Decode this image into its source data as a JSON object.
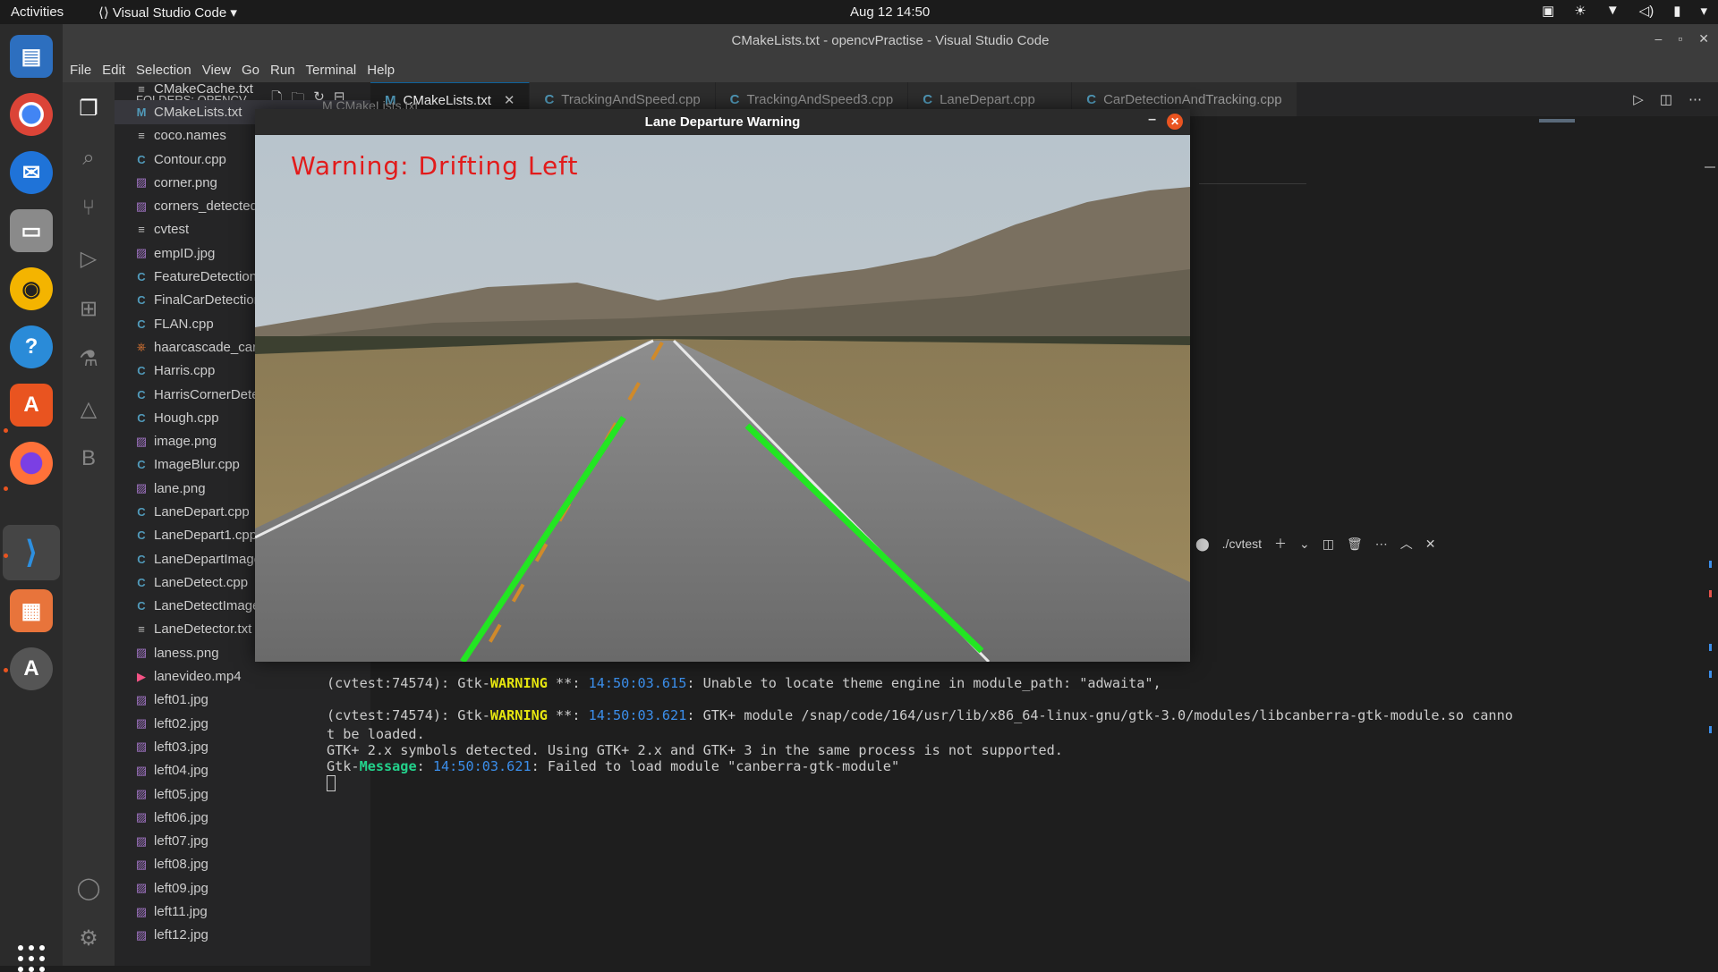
{
  "topbar": {
    "activities": "Activities",
    "app_name": "Visual Studio Code",
    "clock": "Aug 12  14:50"
  },
  "dock": {
    "items": [
      "text-editor-icon",
      "chrome-icon",
      "thunderbird-icon",
      "files-icon",
      "rhythmbox-icon",
      "help-icon",
      "software-center-icon",
      "firefox-icon",
      "vscode-icon",
      "impress-icon",
      "software-updater-icon"
    ]
  },
  "window": {
    "title": "CMakeLists.txt - opencvPractise - Visual Studio Code"
  },
  "menu": [
    "File",
    "Edit",
    "Selection",
    "View",
    "Go",
    "Run",
    "Terminal",
    "Help"
  ],
  "explorer": {
    "header": "FOLDERS: OPENCV...",
    "files": [
      {
        "name": "CMakeCache.txt",
        "type": "txt"
      },
      {
        "name": "CMakeLists.txt",
        "type": "cmake",
        "selected": true
      },
      {
        "name": "coco.names",
        "type": "txt"
      },
      {
        "name": "Contour.cpp",
        "type": "cpp"
      },
      {
        "name": "corner.png",
        "type": "img"
      },
      {
        "name": "corners_detected.png",
        "type": "img"
      },
      {
        "name": "cvtest",
        "type": "txt"
      },
      {
        "name": "empID.jpg",
        "type": "img"
      },
      {
        "name": "FeatureDetection.cpp",
        "type": "cpp"
      },
      {
        "name": "FinalCarDetection.cpp",
        "type": "cpp"
      },
      {
        "name": "FLAN.cpp",
        "type": "cpp"
      },
      {
        "name": "haarcascade_car.xml",
        "type": "xml"
      },
      {
        "name": "Harris.cpp",
        "type": "cpp"
      },
      {
        "name": "HarrisCornerDetection.cp",
        "type": "cpp"
      },
      {
        "name": "Hough.cpp",
        "type": "cpp"
      },
      {
        "name": "image.png",
        "type": "img"
      },
      {
        "name": "ImageBlur.cpp",
        "type": "cpp"
      },
      {
        "name": "lane.png",
        "type": "img"
      },
      {
        "name": "LaneDepart.cpp",
        "type": "cpp"
      },
      {
        "name": "LaneDepart1.cpp",
        "type": "cpp"
      },
      {
        "name": "LaneDepartImage.cpp",
        "type": "cpp"
      },
      {
        "name": "LaneDetect.cpp",
        "type": "cpp"
      },
      {
        "name": "LaneDetectImage.cpp",
        "type": "cpp"
      },
      {
        "name": "LaneDetector.txt",
        "type": "txt"
      },
      {
        "name": "laness.png",
        "type": "img"
      },
      {
        "name": "lanevideo.mp4",
        "type": "mp4"
      },
      {
        "name": "left01.jpg",
        "type": "img"
      },
      {
        "name": "left02.jpg",
        "type": "img"
      },
      {
        "name": "left03.jpg",
        "type": "img"
      },
      {
        "name": "left04.jpg",
        "type": "img"
      },
      {
        "name": "left05.jpg",
        "type": "img"
      },
      {
        "name": "left06.jpg",
        "type": "img"
      },
      {
        "name": "left07.jpg",
        "type": "img"
      },
      {
        "name": "left08.jpg",
        "type": "img"
      },
      {
        "name": "left09.jpg",
        "type": "img"
      },
      {
        "name": "left11.jpg",
        "type": "img"
      },
      {
        "name": "left12.jpg",
        "type": "img"
      }
    ]
  },
  "tabs": [
    {
      "label": "CMakeLists.txt",
      "icon": "M",
      "active": true
    },
    {
      "label": "TrackingAndSpeed.cpp",
      "icon": "C"
    },
    {
      "label": "TrackingAndSpeed3.cpp",
      "icon": "C"
    },
    {
      "label": "LaneDepart.cpp",
      "icon": "C"
    },
    {
      "label": "CarDetectionAndTracking.cpp",
      "icon": "C"
    }
  ],
  "breadcrumb": "M CMakeLists.txt",
  "terminal": {
    "shell_label": "./cvtest",
    "lines": [
      [
        {
          "t": "(cvtest:74574): Gtk-"
        },
        {
          "t": "WARNING",
          "c": "w-yel"
        },
        {
          "t": " **: "
        },
        {
          "t": "14:50:03.615",
          "c": "w-blu"
        },
        {
          "t": ": Unable to locate theme engine in module_path: \"adwaita\","
        }
      ],
      [
        {
          "t": ""
        }
      ],
      [
        {
          "t": "(cvtest:74574): Gtk-"
        },
        {
          "t": "WARNING",
          "c": "w-yel"
        },
        {
          "t": " **: "
        },
        {
          "t": "14:50:03.621",
          "c": "w-blu"
        },
        {
          "t": ": GTK+ module /snap/code/164/usr/lib/x86_64-linux-gnu/gtk-3.0/modules/libcanberra-gtk-module.so canno"
        }
      ],
      [
        {
          "t": "t be loaded."
        }
      ],
      [
        {
          "t": "GTK+ 2.x symbols detected. Using GTK+ 2.x and GTK+ 3 in the same process is not supported."
        }
      ],
      [
        {
          "t": "Gtk-"
        },
        {
          "t": "Message",
          "c": "w-grn"
        },
        {
          "t": ": "
        },
        {
          "t": "14:50:03.621",
          "c": "w-blu"
        },
        {
          "t": ": Failed to load module \"canberra-gtk-module\""
        }
      ]
    ]
  },
  "popup": {
    "title": "Lane Departure Warning",
    "warning": "Warning: Drifting Left"
  },
  "colors": {
    "lane_line": "#22e622",
    "warning": "#e21b1b",
    "accent": "#e95420"
  }
}
